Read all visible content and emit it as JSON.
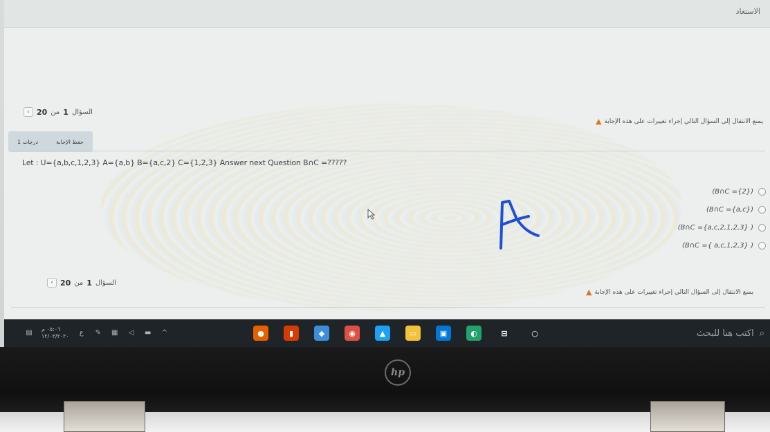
{
  "top_bar": {
    "title": "الاستغاد"
  },
  "navigation": {
    "question_label": "السؤال",
    "current": "1",
    "of": "من",
    "total": "20",
    "prev_arrow": "‹",
    "warning": "يمنع الانتقال إلى السؤال التالي إجراء تغييرات على هذه الإجابة"
  },
  "tabs": {
    "grade": "1 درجات",
    "save": "حفظ الإجابة"
  },
  "question": {
    "text": "Let : U={a,b,c,1,2,3} A={a,b} B={a,c,2} C={1,2,3} Answer next Question B∩C =?????"
  },
  "options": [
    {
      "label": "(B∩C ={2})"
    },
    {
      "label": "(B∩C ={a,c})"
    },
    {
      "label": "(B∩C ={a,c,2,1,2,3} )"
    },
    {
      "label": "(B∩C ={ a,c,1,2,3} )"
    }
  ],
  "handwritten_answer": "A",
  "taskbar": {
    "time": "٠٥:٠٦ م",
    "date": "١٢/٠٣/٢٠٢٠",
    "search_placeholder": "اكتب هنا للبحث",
    "apps": [
      {
        "icon": "firefox-icon",
        "color": "#e66000"
      },
      {
        "icon": "office-icon",
        "color": "#d83b01"
      },
      {
        "icon": "store-cube-icon",
        "color": "#3b8fd8"
      },
      {
        "icon": "chrome-icon",
        "color": "#dd5144"
      },
      {
        "icon": "twitter-icon",
        "color": "#1da1f2"
      },
      {
        "icon": "file-explorer-icon",
        "color": "#f3c13a"
      },
      {
        "icon": "store-bag-icon",
        "color": "#0078d7"
      },
      {
        "icon": "edge-icon",
        "color": "#1fa36a"
      },
      {
        "icon": "task-view-icon",
        "color": "#1f2428"
      },
      {
        "icon": "cortana-icon",
        "color": "#1f2428"
      }
    ]
  },
  "laptop": {
    "brand": "hp"
  }
}
